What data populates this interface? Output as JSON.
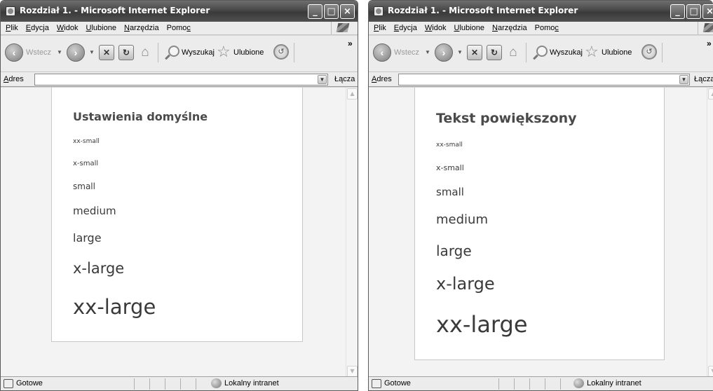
{
  "windows": {
    "left": {
      "title": "Rozdział 1. - Microsoft Internet Explorer",
      "heading": "Ustawienia domyślne",
      "sizes": [
        "xx-small",
        "x-small",
        "small",
        "medium",
        "large",
        "x-large",
        "xx-large"
      ]
    },
    "right": {
      "title": "Rozdział 1. - Microsoft Internet Explorer",
      "heading": "Tekst powiększony",
      "sizes": [
        "xx-small",
        "x-small",
        "small",
        "medium",
        "large",
        "x-large",
        "xx-large"
      ]
    }
  },
  "menu": {
    "file": {
      "u": "P",
      "rest": "lik"
    },
    "edit": {
      "u": "E",
      "rest": "dycja"
    },
    "view": {
      "u": "W",
      "rest": "idok"
    },
    "favorites": {
      "u": "U",
      "rest": "lubione"
    },
    "tools": {
      "u": "N",
      "rest": "arzędzia"
    },
    "help": {
      "pre": "Pomo",
      "u": "c"
    }
  },
  "toolbar": {
    "back": "Wstecz",
    "search": "Wyszukaj",
    "favorites": "Ulubione",
    "more": "»"
  },
  "address": {
    "label_u": "A",
    "label_rest": "dres",
    "value": "",
    "links": "Łącza"
  },
  "status": {
    "text": "Gotowe",
    "zone": "Lokalny intranet"
  }
}
